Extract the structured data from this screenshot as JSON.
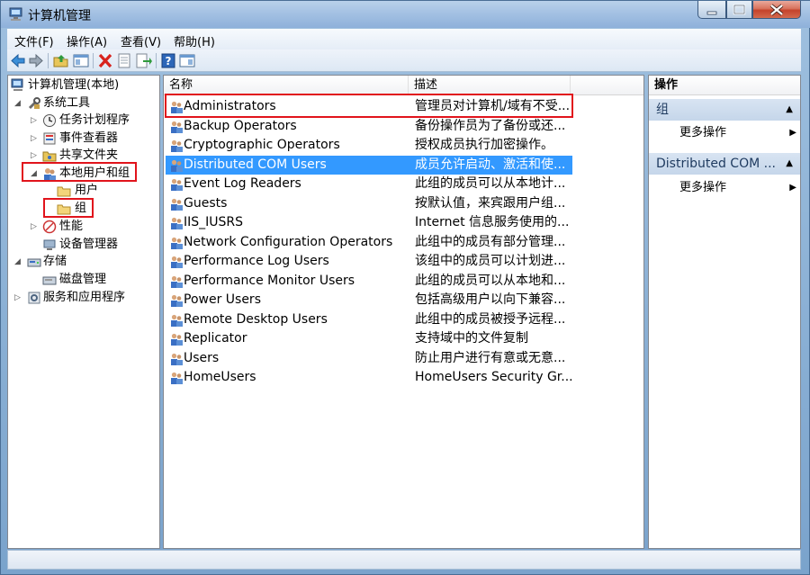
{
  "window": {
    "title": "计算机管理"
  },
  "menu": [
    "文件(F)",
    "操作(A)",
    "查看(V)",
    "帮助(H)"
  ],
  "toolbar": [
    "back-arrow-icon",
    "forward-arrow-icon",
    "up-folder-icon",
    "show-hide-tree-icon",
    "delete-icon",
    "properties-icon",
    "export-list-icon",
    "help-icon",
    "show-hide-action-pane-icon"
  ],
  "tree": {
    "root": "计算机管理(本地)",
    "system_tools": "系统工具",
    "task_scheduler": "任务计划程序",
    "event_viewer": "事件查看器",
    "shared_folders": "共享文件夹",
    "local_users_groups": "本地用户和组",
    "users": "用户",
    "groups": "组",
    "performance": "性能",
    "device_manager": "设备管理器",
    "storage": "存储",
    "disk_management": "磁盘管理",
    "services_apps": "服务和应用程序"
  },
  "columns": {
    "name": "名称",
    "desc": "描述"
  },
  "groups": [
    {
      "name": "Administrators",
      "desc": "管理员对计算机/域有不受..."
    },
    {
      "name": "Backup Operators",
      "desc": "备份操作员为了备份或还..."
    },
    {
      "name": "Cryptographic Operators",
      "desc": "授权成员执行加密操作。"
    },
    {
      "name": "Distributed COM Users",
      "desc": "成员允许启动、激活和使..."
    },
    {
      "name": "Event Log Readers",
      "desc": "此组的成员可以从本地计..."
    },
    {
      "name": "Guests",
      "desc": "按默认值，来宾跟用户组..."
    },
    {
      "name": "IIS_IUSRS",
      "desc": "Internet 信息服务使用的..."
    },
    {
      "name": "Network Configuration Operators",
      "desc": "此组中的成员有部分管理..."
    },
    {
      "name": "Performance Log Users",
      "desc": "该组中的成员可以计划进..."
    },
    {
      "name": "Performance Monitor Users",
      "desc": "此组的成员可以从本地和..."
    },
    {
      "name": "Power Users",
      "desc": "包括高级用户以向下兼容..."
    },
    {
      "name": "Remote Desktop Users",
      "desc": "此组中的成员被授予远程..."
    },
    {
      "name": "Replicator",
      "desc": "支持域中的文件复制"
    },
    {
      "name": "Users",
      "desc": "防止用户进行有意或无意..."
    },
    {
      "name": "HomeUsers",
      "desc": "HomeUsers Security Gr..."
    }
  ],
  "selected_group": "Distributed COM Users",
  "actions": {
    "header": "操作",
    "section1": "组",
    "section2": "Distributed COM ...",
    "more": "更多操作"
  },
  "colors": {
    "selection": "#3399ff",
    "highlight_box": "#e1141c"
  }
}
